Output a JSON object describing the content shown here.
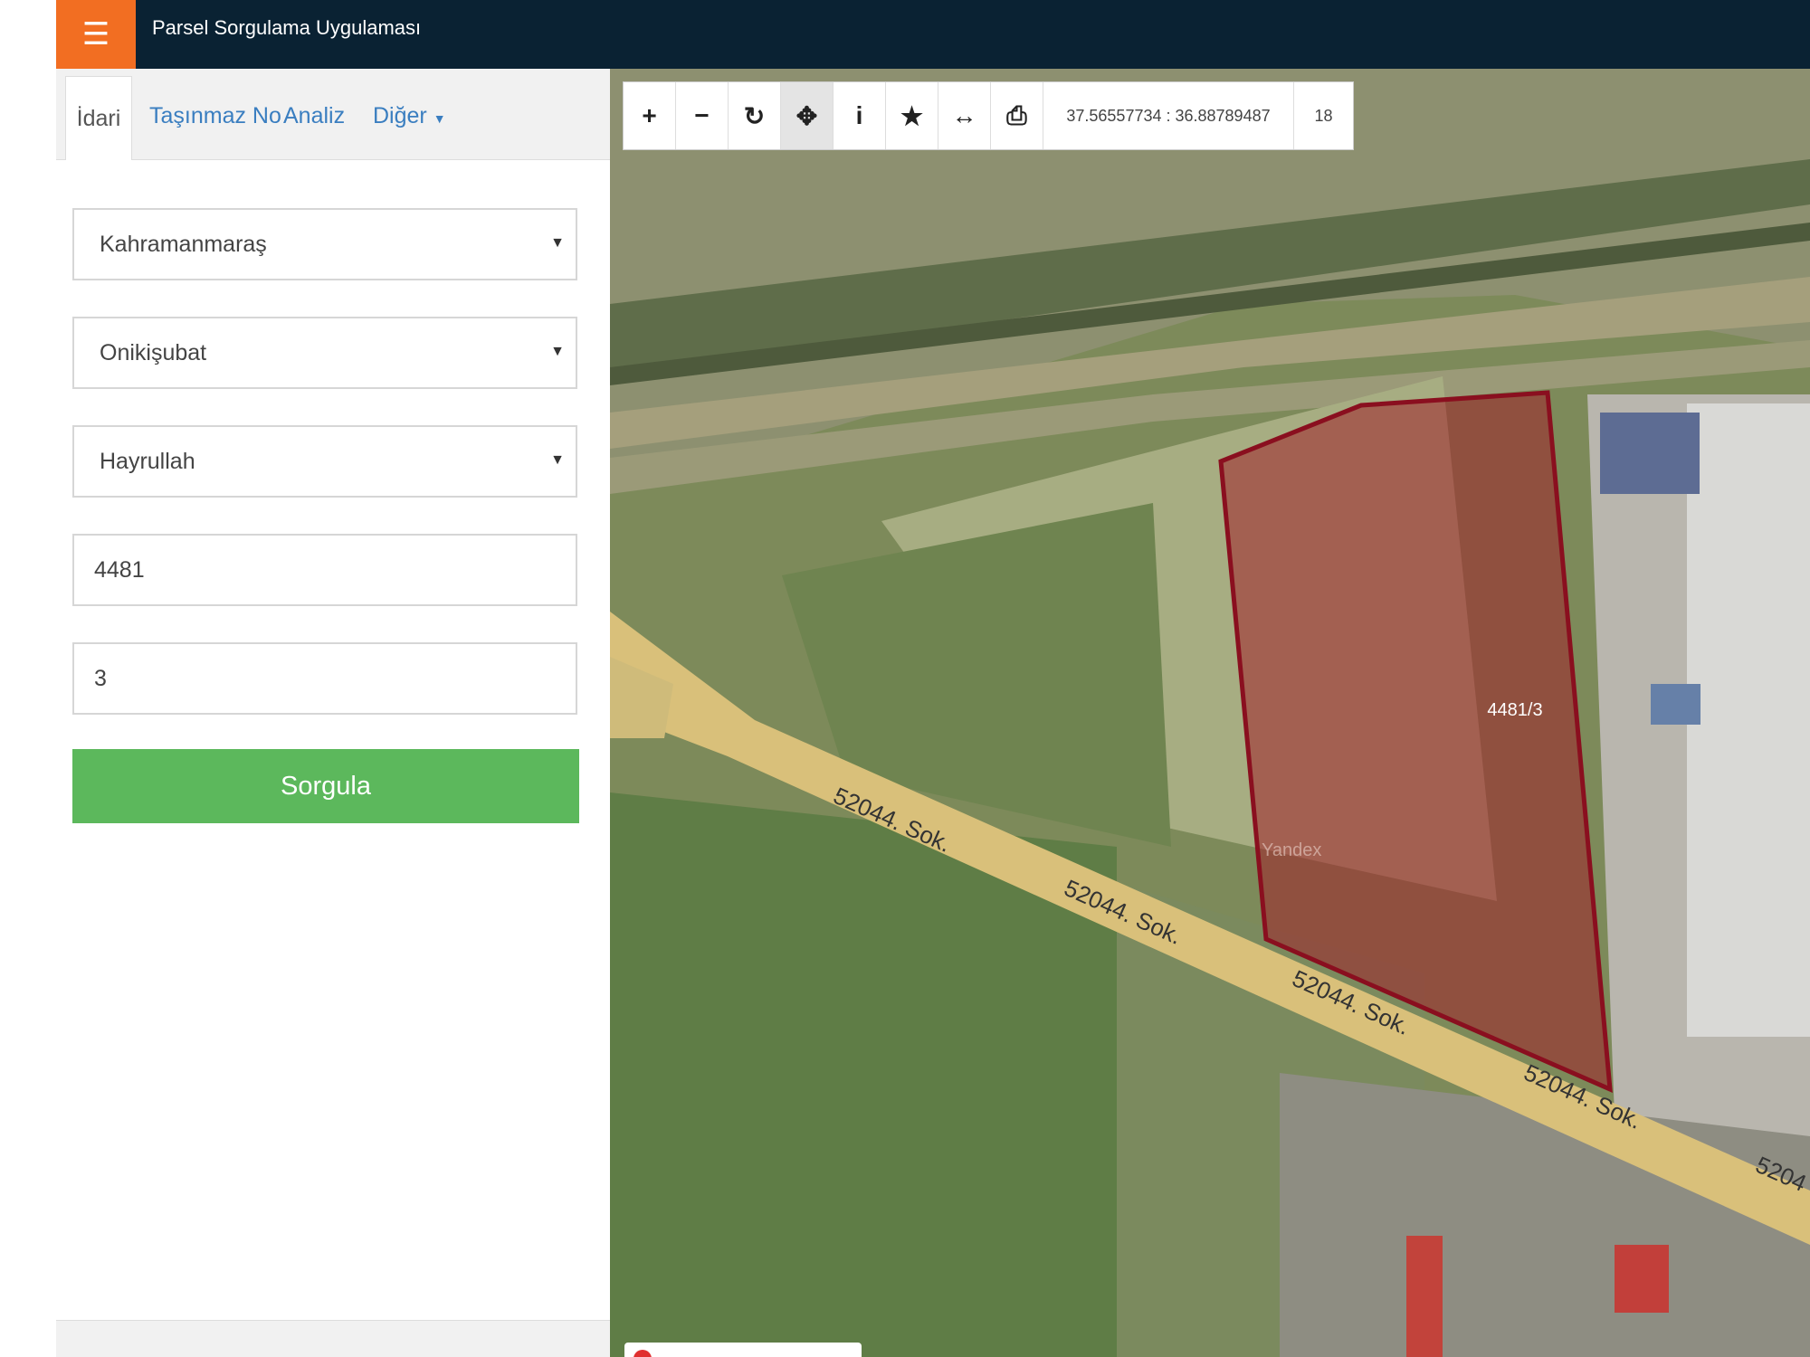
{
  "header": {
    "title_line2": "Parsel Sorgulama Uygulaması",
    "brand_color": "#0a2233",
    "menu_color": "#f26e22"
  },
  "sidebar": {
    "tabs": [
      {
        "label": "İdari",
        "active": true
      },
      {
        "label": "Taşınmaz No",
        "active": false
      },
      {
        "label": "Analiz",
        "active": false
      },
      {
        "label": "Diğer",
        "active": false
      }
    ],
    "fields": {
      "province": "Kahramanmaraş",
      "district": "Onikişubat",
      "neighborhood": "Hayrullah",
      "block": "4481",
      "parcel": "3"
    },
    "submit_label": "Sorgula",
    "submit_color": "#5cb85c"
  },
  "map": {
    "coordinates": "37.56557734 : 36.88789487",
    "zoom_level": "18",
    "parcel_label": "4481/3",
    "road_labels": [
      "52044. Sok.",
      "52044. Sok.",
      "52044. Sok.",
      "52044. Sok.",
      "5204"
    ],
    "watermark": "Yandex",
    "parcel_color": "#a0202a"
  }
}
